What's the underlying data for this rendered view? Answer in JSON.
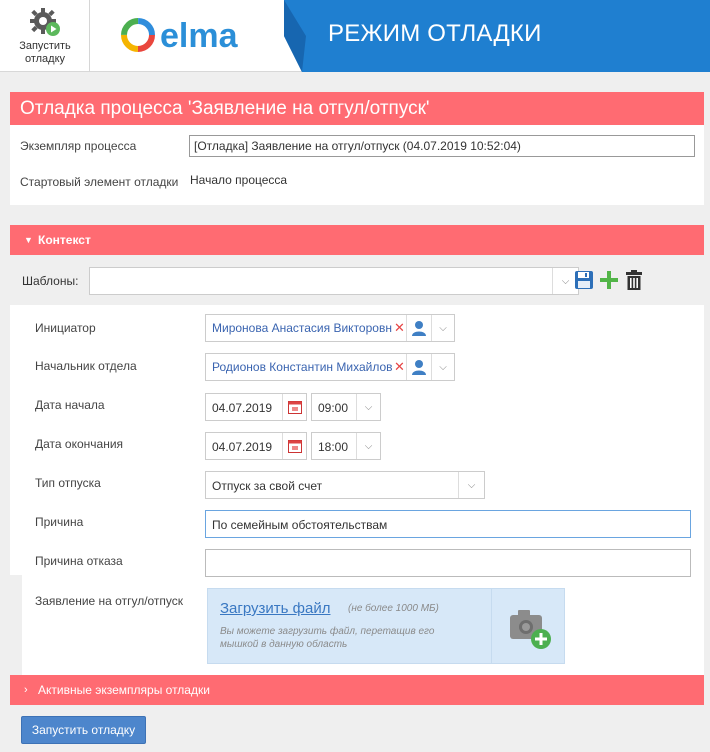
{
  "toolbar": {
    "run_debug_label": "Запустить отладку",
    "logo_text": "elma"
  },
  "banner": {
    "title": "РЕЖИМ ОТЛАДКИ"
  },
  "page": {
    "title": "Отладка процесса 'Заявление на отгул/отпуск'",
    "instance_label": "Экземпляр процесса",
    "instance_value": "[Отладка] Заявление на отгул/отпуск (04.07.2019 10:52:04)",
    "start_element_label": "Стартовый элемент отладки",
    "start_element_value": "Начало процесса"
  },
  "context": {
    "title": "Контекст",
    "templates_label": "Шаблоны:",
    "templates_value": "",
    "fields": {
      "initiator": {
        "label": "Инициатор",
        "value": "Миронова Анастасия Викторовна"
      },
      "manager": {
        "label": "Начальник отдела",
        "value": "Родионов Константин Михайлович"
      },
      "start_date": {
        "label": "Дата начала",
        "date": "04.07.2019",
        "time": "09:00"
      },
      "end_date": {
        "label": "Дата окончания",
        "date": "04.07.2019",
        "time": "18:00"
      },
      "leave_type": {
        "label": "Тип отпуска",
        "value": "Отпуск за свой счет"
      },
      "reason": {
        "label": "Причина",
        "value": "По семейным обстоятельствам"
      },
      "refusal_reason": {
        "label": "Причина отказа",
        "value": ""
      },
      "application": {
        "label": "Заявление на отгул/отпуск",
        "upload_link": "Загрузить файл",
        "upload_limit": "(не более 1000 МБ)",
        "upload_hint": "Вы можете загрузить файл, перетащив его мышкой в данную область"
      }
    }
  },
  "active_instances": {
    "title": "Активные экземпляры отладки"
  },
  "footer": {
    "run_button": "Запустить отладку"
  },
  "colors": {
    "accent": "#ff6b72",
    "banner": "#1f7fd0",
    "primary_button": "#4d86cc"
  }
}
